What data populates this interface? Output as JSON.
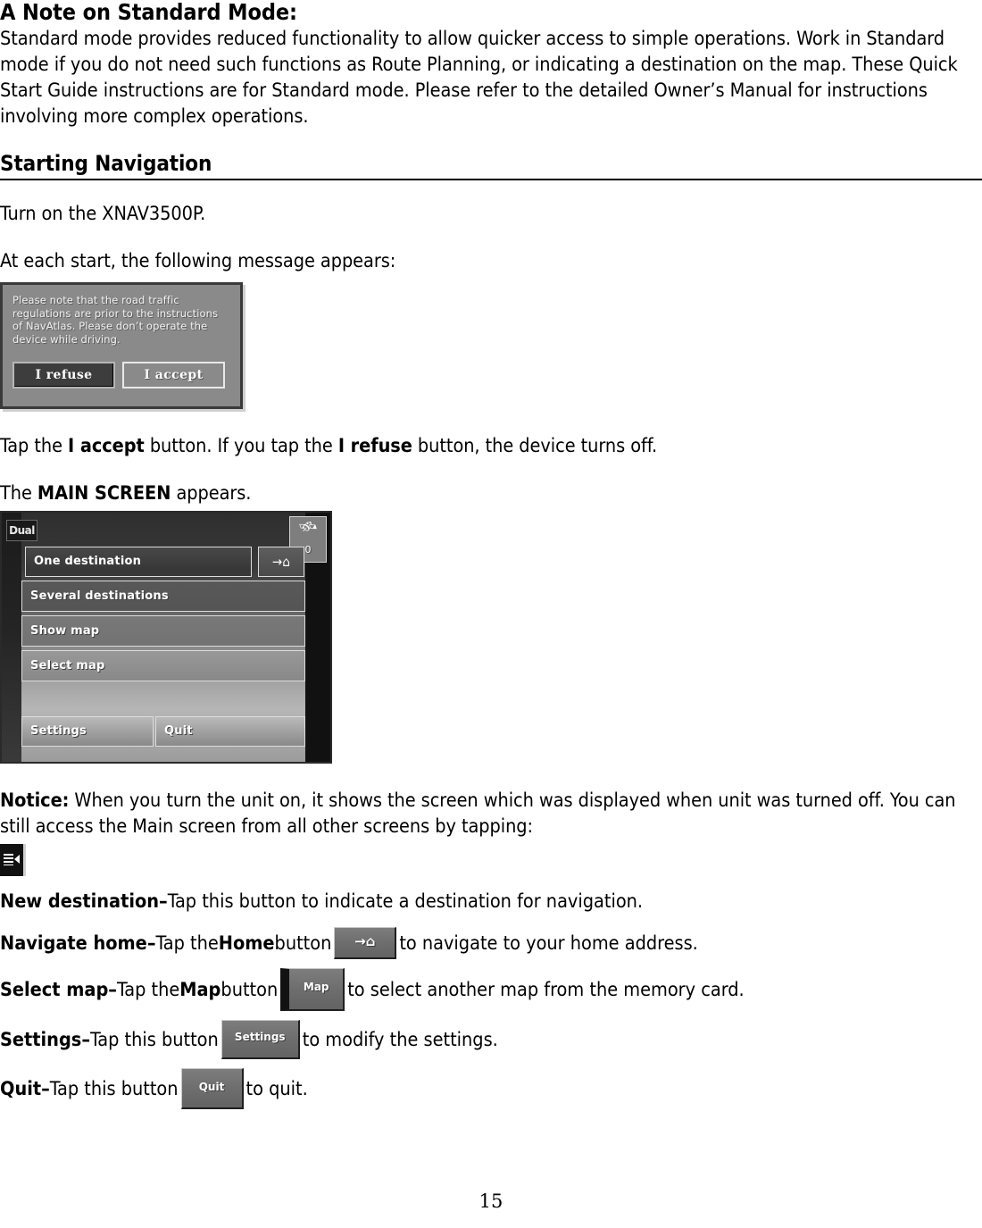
{
  "document": {
    "page_number": "15",
    "sections": {
      "note_heading": "A Note on Standard Mode:",
      "note_body": "Standard mode provides reduced functionality to allow quicker access to simple operations. Work in Standard mode if you do not need such functions as Route Planning, or indicating a destination on the map. These Quick Start Guide instructions are for Standard mode. Please refer to the detailed Owner’s Manual for instructions involving more complex operations.",
      "starting_navigation_heading": "Starting Navigation",
      "turn_on_line": "Turn on the XNAV3500P.",
      "at_each_start_line": "At each start, the following message appears:",
      "tap_accept_line": {
        "part1": "Tap the ",
        "bold1": "I accept",
        "part2": " button. If you tap the ",
        "bold2": "I refuse",
        "part3": " button, the device turns off."
      },
      "main_screen_line": {
        "part1": "The ",
        "bold1": "MAIN SCREEN",
        "part2": " appears."
      },
      "notice": {
        "label": "Notice:",
        "text": " When you turn the unit on, it shows the screen which was displayed when unit was turned off. You can still access the Main screen from all other screens by tapping:"
      }
    }
  },
  "dialog_screenshot": {
    "message": "Please note that the road traffic regulations are prior to the instructions of NavAtlas. Please don’t operate the device while driving.",
    "buttons": [
      {
        "label": "I refuse",
        "state": "selected"
      },
      {
        "label": "I accept",
        "state": "normal"
      }
    ]
  },
  "main_screen_screenshot": {
    "brand": "Dual",
    "gps": {
      "icon": "satellite-icon",
      "satellite_count": "0"
    },
    "menu_items": [
      "One destination",
      "Several destinations",
      "Show map",
      "Select map"
    ],
    "home_button_icon": "arrow-to-home-icon",
    "bottom_buttons": [
      "Settings",
      "Quit"
    ]
  },
  "button_descriptions": [
    {
      "term": "New destination",
      "dash": " – ",
      "text_before": "Tap this button to indicate a destination for navigation.",
      "inline_button": null,
      "text_after": ""
    },
    {
      "term": "Navigate home",
      "dash": " – ",
      "text_before": "Tap the ",
      "bold_mid": "Home",
      "text_mid": " button ",
      "inline_button": {
        "label": "",
        "icon": "arrow-to-home-icon",
        "kind": "home"
      },
      "text_after": " to navigate to your home address."
    },
    {
      "term": "Select map",
      "dash": " – ",
      "text_before": "Tap the ",
      "bold_mid": "Map",
      "text_mid": " button ",
      "inline_button": {
        "label": "Map",
        "icon": null,
        "kind": "map"
      },
      "text_after": " to select another map from the memory card."
    },
    {
      "term": "Settings",
      "dash": " – ",
      "text_before": "Tap this button ",
      "bold_mid": "",
      "text_mid": "",
      "inline_button": {
        "label": "Settings",
        "icon": null,
        "kind": "settings"
      },
      "text_after": " to modify the settings."
    },
    {
      "term": "Quit",
      "dash": " – ",
      "text_before": "Tap this button ",
      "bold_mid": "",
      "text_mid": "",
      "inline_button": {
        "label": "Quit",
        "icon": null,
        "kind": "quit"
      },
      "text_after": " to quit."
    }
  ],
  "tap_icon_name": "main-menu-icon"
}
